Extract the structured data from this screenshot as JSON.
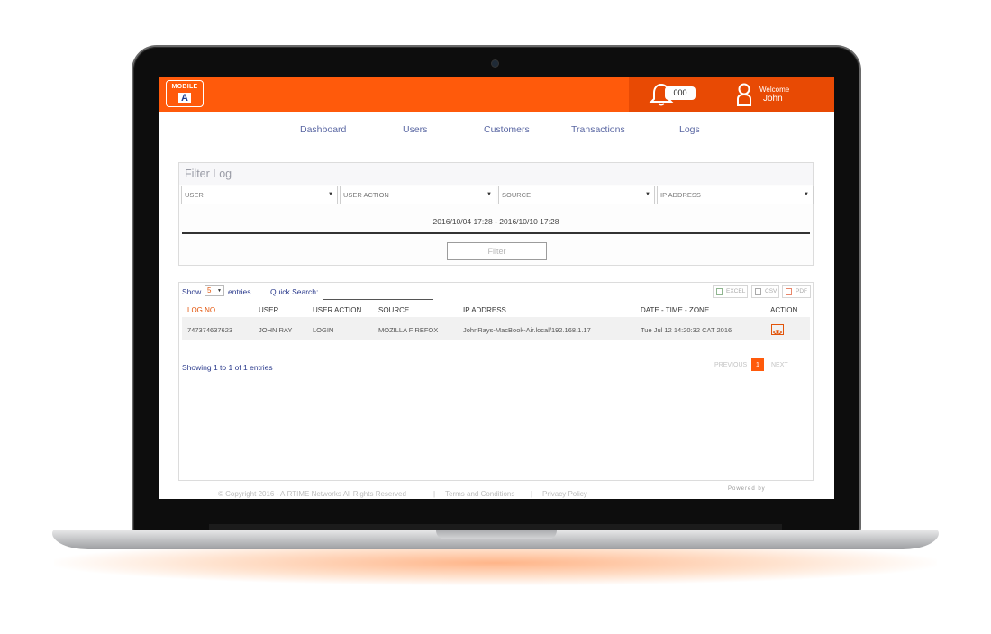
{
  "header": {
    "logo_word": "MOBILE",
    "logo_letter": "A",
    "notification_count": "000",
    "welcome_text": "Welcome",
    "username": "John",
    "brand_color": "#ff5a0b"
  },
  "nav": {
    "items": [
      {
        "label": "Dashboard"
      },
      {
        "label": "Users"
      },
      {
        "label": "Customers"
      },
      {
        "label": "Transactions"
      },
      {
        "label": "Logs"
      }
    ]
  },
  "filter": {
    "title": "Filter Log",
    "selects": [
      {
        "label": "USER"
      },
      {
        "label": "USER ACTION"
      },
      {
        "label": "SOURCE"
      },
      {
        "label": "IP ADDRESS"
      }
    ],
    "date_range": "2016/10/04 17:28 - 2016/10/10 17:28",
    "button_label": "Filter"
  },
  "table": {
    "show_label": "Show",
    "page_size": "5",
    "entries_label": "entries",
    "quick_search_label": "Quick Search:",
    "quick_search_value": "",
    "export": [
      "EXCEL",
      "CSV",
      "PDF"
    ],
    "columns": [
      "LOG NO",
      "USER",
      "USER ACTION",
      "SOURCE",
      "IP ADDRESS",
      "DATE - TIME - ZONE",
      "ACTION"
    ],
    "rows": [
      {
        "log_no": "747374637623",
        "user": "JOHN RAY",
        "action": "LOGIN",
        "source": "MOZILLA FIREFOX",
        "ip": "JohnRays-MacBook-Air.local/192.168.1.17",
        "datetime": "Tue Jul 12 14:20:32 CAT 2016"
      }
    ],
    "summary": "Showing 1 to 1 of 1 entries",
    "pager": {
      "previous": "PREVIOUS",
      "current": "1",
      "next": "NEXT"
    }
  },
  "footer": {
    "copyright": "© Copyright 2016 - AIRTIME Networks All Rights Reserved",
    "separator": "|",
    "terms": "Terms and Conditions",
    "privacy": "Privacy Policy",
    "powered_by": "Powered by"
  }
}
